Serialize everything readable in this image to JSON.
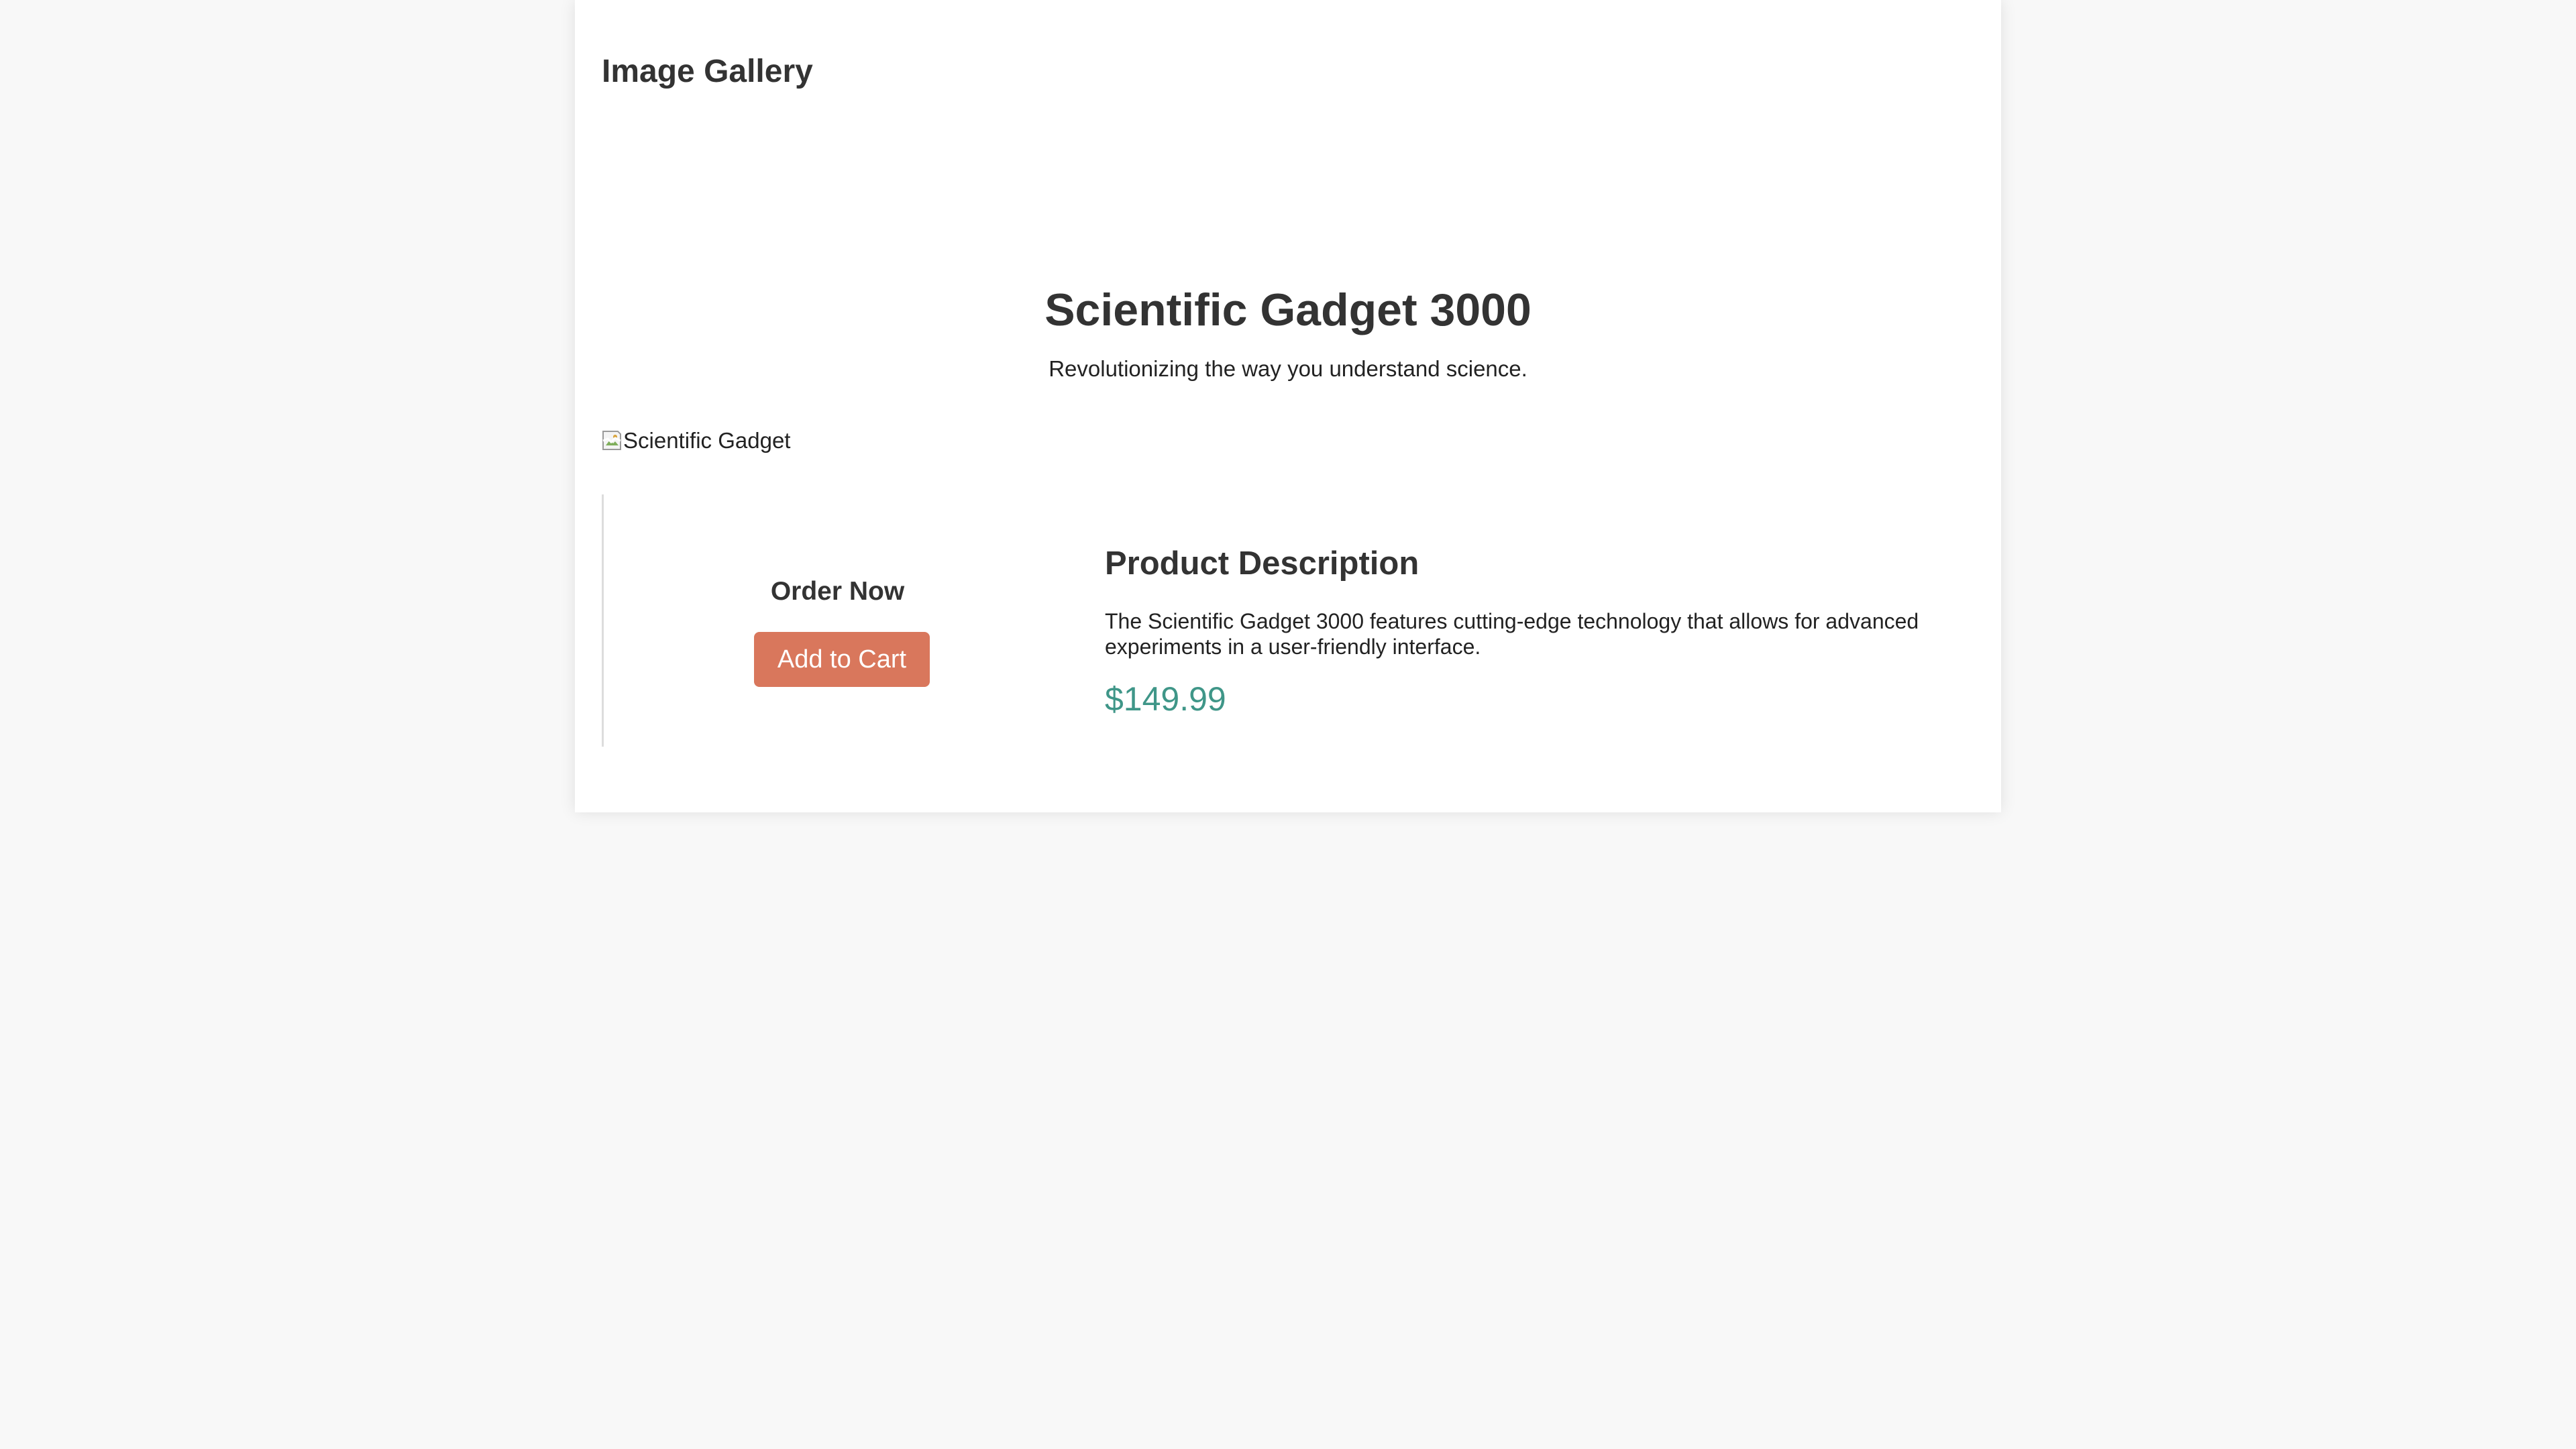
{
  "header": {
    "title": "Image Gallery"
  },
  "hero": {
    "title": "Scientific Gadget 3000",
    "subtitle": "Revolutionizing the way you understand science."
  },
  "product_image": {
    "alt": "Scientific Gadget",
    "icon": "broken-image-icon"
  },
  "order": {
    "title": "Order Now",
    "button_label": "Add to Cart"
  },
  "description": {
    "title": "Product Description",
    "text": "The Scientific Gadget 3000 features cutting-edge technology that allows for advanced experiments in a user-friendly interface.",
    "price": "$149.99"
  },
  "colors": {
    "background": "#f8f8f8",
    "card": "#ffffff",
    "text": "#333333",
    "button": "#d9775c",
    "price": "#3f9688"
  }
}
